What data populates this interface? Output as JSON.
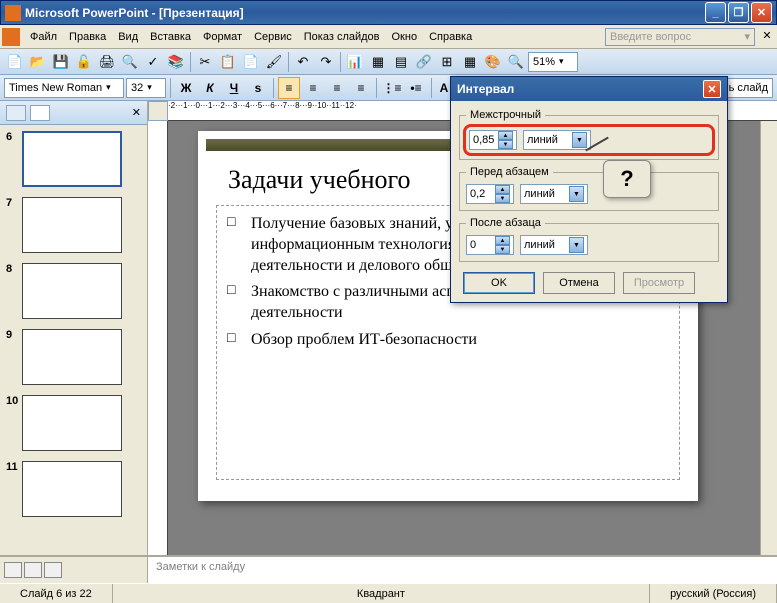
{
  "window": {
    "title": "Microsoft PowerPoint - [Презентация]"
  },
  "menu": {
    "file": "Файл",
    "edit": "Правка",
    "view": "Вид",
    "insert": "Вставка",
    "format": "Формат",
    "tools": "Сервис",
    "show": "Показ слайдов",
    "window": "Окно",
    "help": "Справка",
    "question": "Введите вопрос"
  },
  "toolbar": {
    "zoom": "51%"
  },
  "fontbar": {
    "font": "Times New Roman",
    "size": "32",
    "B": "Ж",
    "I": "К",
    "U": "Ч",
    "S": "s",
    "A": "A"
  },
  "taskpane": {
    "newslide": "ь слайд"
  },
  "thumbs": [
    {
      "n": "6",
      "sel": true
    },
    {
      "n": "7"
    },
    {
      "n": "8"
    },
    {
      "n": "9"
    },
    {
      "n": "10"
    },
    {
      "n": "11"
    }
  ],
  "slide": {
    "title": "Задачи учебного",
    "items": [
      "Получение базовых знаний, умений и навыков по информационным технологиям, основам офисной деятельности и делового общения",
      "Знакомство с различными аспектами организации офисной деятельности",
      "Обзор проблем ИТ-безопасности"
    ]
  },
  "ruler": "·2···1···0···1···2···3···4···5···6···7···8···9··10··11··12·",
  "notes": "Заметки к слайду",
  "status": {
    "slide": "Слайд 6 из 22",
    "layout": "Квадрант",
    "lang": "русский (Россия)"
  },
  "dialog": {
    "title": "Интервал",
    "g1": "Межстрочный",
    "v1": "0,85",
    "u1": "линий",
    "g2": "Перед абзацем",
    "v2": "0,2",
    "u2": "линий",
    "g3": "После абзаца",
    "v3": "0",
    "u3": "линий",
    "ok": "OK",
    "cancel": "Отмена",
    "preview": "Просмотр"
  },
  "callout": "?"
}
